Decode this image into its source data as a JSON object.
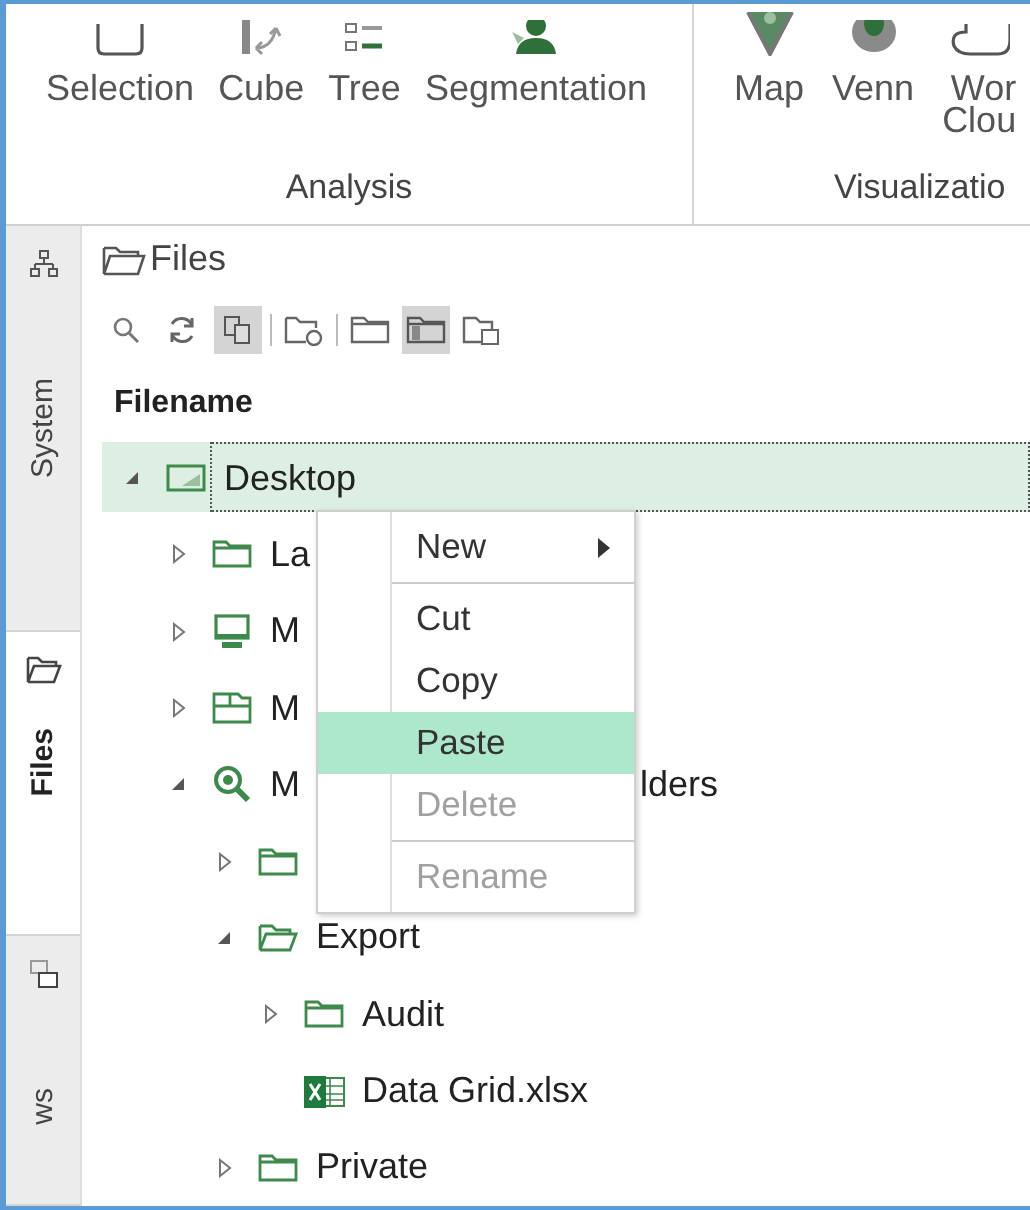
{
  "ribbon": {
    "groups": [
      {
        "label": "Analysis",
        "buttons": [
          {
            "label": "Selection"
          },
          {
            "label": "Cube"
          },
          {
            "label": "Tree"
          },
          {
            "label": "Segmentation"
          }
        ]
      },
      {
        "label": "Visualizatio",
        "buttons": [
          {
            "label": "Map"
          },
          {
            "label": "Venn"
          },
          {
            "label": "Wor\nClou"
          }
        ]
      }
    ]
  },
  "sidebar": {
    "tabs": [
      {
        "label": "System",
        "selected": false
      },
      {
        "label": "Files",
        "selected": true
      },
      {
        "label": "ws",
        "selected": false
      }
    ]
  },
  "panel": {
    "title": "Files",
    "toolbar": [
      [
        {
          "pressed": false
        },
        {
          "pressed": false
        },
        {
          "pressed": true
        }
      ],
      [
        {
          "pressed": false
        }
      ],
      [
        {
          "pressed": false
        },
        {
          "pressed": true
        },
        {
          "pressed": false
        }
      ]
    ],
    "column": "Filename",
    "tree": [
      {
        "label": "Desktop",
        "kind": "desktop",
        "selected": true,
        "expanded": true,
        "children": [
          {
            "label": "La",
            "kind": "folder",
            "selected": false,
            "expanded": false
          },
          {
            "label": "M",
            "kind": "computer",
            "selected": false,
            "expanded": false
          },
          {
            "label": "M",
            "kind": "network",
            "selected": false,
            "expanded": false
          },
          {
            "label": "M",
            "label_after_menu": "lders",
            "kind": "search",
            "selected": false,
            "expanded": true,
            "children": [
              {
                "kind": "folder",
                "selected": false,
                "expanded": false
              },
              {
                "label": "Export",
                "kind": "folder",
                "selected": false,
                "expanded": true,
                "children": [
                  {
                    "label": "Audit",
                    "kind": "folder",
                    "selected": false,
                    "expanded": false
                  },
                  {
                    "label": "Data Grid.xlsx",
                    "kind": "spreadsheet",
                    "selected": false
                  }
                ]
              },
              {
                "label": "Private",
                "kind": "folder",
                "selected": false,
                "expanded": false
              }
            ]
          }
        ]
      }
    ]
  },
  "context_menu": [
    {
      "label": "New",
      "kind": "submenu",
      "selected": false,
      "disabled": false,
      "separator_after": true
    },
    {
      "label": "Cut",
      "kind": "item",
      "selected": false,
      "disabled": false,
      "separator_after": false
    },
    {
      "label": "Copy",
      "kind": "item",
      "selected": false,
      "disabled": false,
      "separator_after": false
    },
    {
      "label": "Paste",
      "kind": "item",
      "selected": true,
      "disabled": false,
      "separator_after": false
    },
    {
      "label": "Delete",
      "kind": "item",
      "selected": false,
      "disabled": true,
      "separator_after": true
    },
    {
      "label": "Rename",
      "kind": "item",
      "selected": false,
      "disabled": true,
      "separator_after": false
    }
  ]
}
